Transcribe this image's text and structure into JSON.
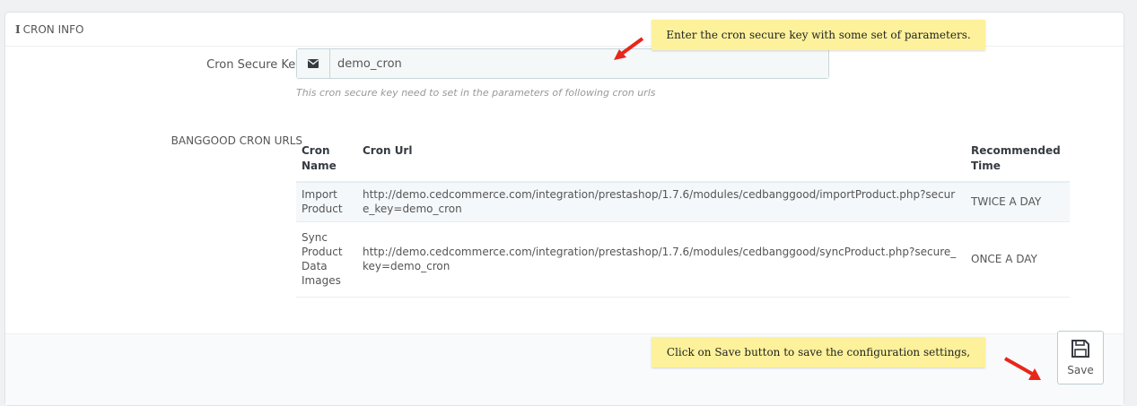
{
  "panel": {
    "title": "CRON INFO"
  },
  "form": {
    "secure_key_label": "Cron Secure Key",
    "secure_key_value": "demo_cron",
    "secure_key_help": "This cron secure key need to set in the parameters of following cron urls",
    "urls_label": "BANGGOOD CRON URLS"
  },
  "table": {
    "headers": {
      "name": "Cron Name",
      "url": "Cron Url",
      "time": "Recommended Time"
    },
    "rows": [
      {
        "name": "Import Product",
        "url": "http://demo.cedcommerce.com/integration/prestashop/1.7.6/modules/cedbanggood/importProduct.php?secure_key=demo_cron",
        "time": "TWICE A DAY"
      },
      {
        "name": "Sync Product Data Images",
        "url": "http://demo.cedcommerce.com/integration/prestashop/1.7.6/modules/cedbanggood/syncProduct.php?secure_key=demo_cron",
        "time": "ONCE A DAY"
      }
    ]
  },
  "footer": {
    "save_label": "Save"
  },
  "callouts": {
    "top": "Enter the cron secure key with some set of parameters.",
    "bottom": "Click on Save button to save the configuration settings,"
  },
  "colors": {
    "callout_bg": "#fdf29b",
    "arrow": "#e8261a"
  }
}
